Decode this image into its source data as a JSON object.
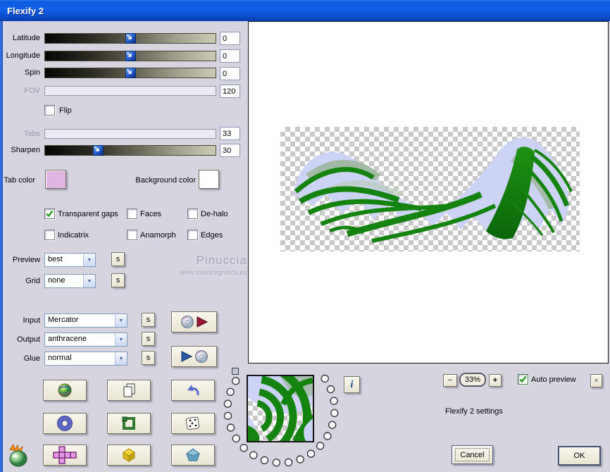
{
  "window": {
    "title": "Flexify 2"
  },
  "left_panel": {
    "sliders": [
      {
        "label": "Latitude",
        "value": "0",
        "pct": 50,
        "disabled": false
      },
      {
        "label": "Longitude",
        "value": "0",
        "pct": 50,
        "disabled": false
      },
      {
        "label": "Spin",
        "value": "0",
        "pct": 50,
        "disabled": false
      },
      {
        "label": "FOV",
        "value": "120",
        "pct": null,
        "disabled": true
      },
      {
        "label": "Tabs",
        "value": "33",
        "pct": null,
        "disabled": true
      },
      {
        "label": "Sharpen",
        "value": "30",
        "pct": 31,
        "disabled": false
      }
    ],
    "flip": {
      "label": "Flip",
      "checked": false
    },
    "tab_color": {
      "label": "Tab color",
      "color": "#e2b4e2"
    },
    "background_color": {
      "label": "Background color",
      "color": "#ffffff"
    },
    "options": [
      {
        "label": "Transparent gaps",
        "checked": true
      },
      {
        "label": "Faces",
        "checked": false
      },
      {
        "label": "De-halo",
        "checked": false
      },
      {
        "label": "Indicatrix",
        "checked": false
      },
      {
        "label": "Anamorph",
        "checked": false
      },
      {
        "label": "Edges",
        "checked": false
      }
    ],
    "combos": [
      {
        "label": "Preview",
        "value": "best"
      },
      {
        "label": "Grid",
        "value": "none"
      },
      {
        "label": "Input",
        "value": "Mercator"
      },
      {
        "label": "Output",
        "value": "anthracene"
      },
      {
        "label": "Glue",
        "value": "normal"
      }
    ],
    "s_button": "s"
  },
  "watermark": {
    "line1": "Pinuccia",
    "line2": "www.maidiregrafica.eu"
  },
  "icons": {
    "combo_chevron": "▼"
  },
  "preview_footer": {
    "zoom_out": "−",
    "zoom_level": "33%",
    "zoom_in": "+",
    "auto_preview": {
      "label": "Auto preview",
      "checked": true
    },
    "collapse": "^",
    "info": "i",
    "status_text": "Flexify 2 settings",
    "cancel": "Cancel",
    "ok": "OK"
  }
}
